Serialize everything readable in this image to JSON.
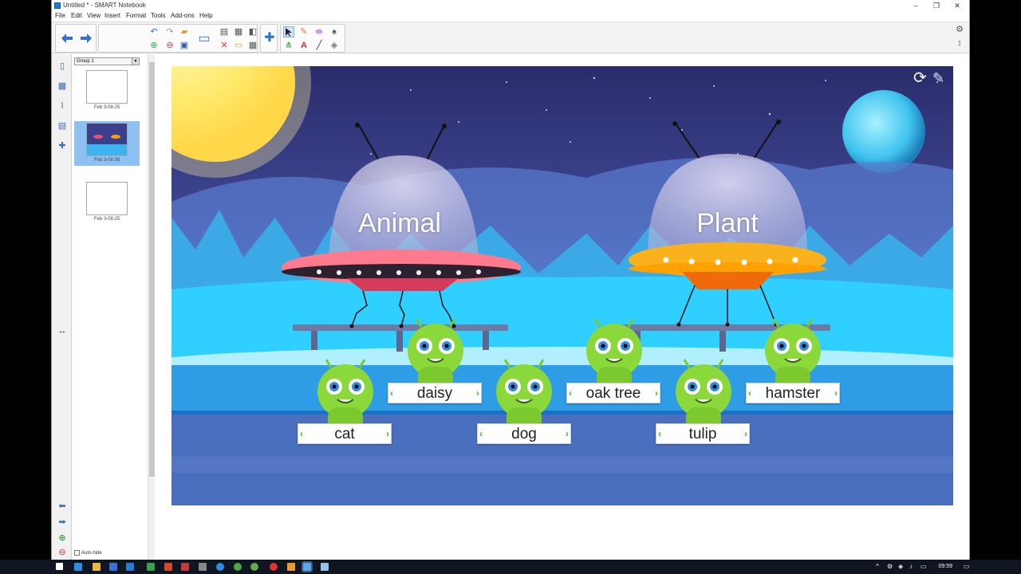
{
  "window": {
    "title": "Untitled * - SMART Notebook",
    "minimize": "–",
    "maximize": "❐",
    "close": "✕"
  },
  "menu": [
    "File",
    "Edit",
    "View",
    "Insert",
    "Format",
    "Tools",
    "Add-ons",
    "Help"
  ],
  "sorter": {
    "group": "Group 1",
    "pages": [
      {
        "label": "Feb 3-08:25",
        "selected": false
      },
      {
        "label": "Feb 3-08:58",
        "selected": true
      },
      {
        "label": "Feb 3-08:25",
        "selected": false
      }
    ],
    "autohide": "Auto-hide"
  },
  "activity": {
    "groups": [
      {
        "label": "Animal",
        "color": "#e8556b"
      },
      {
        "label": "Plant",
        "color": "#f5a10f"
      }
    ],
    "cards": [
      {
        "label": "daisy"
      },
      {
        "label": "oak tree"
      },
      {
        "label": "hamster"
      },
      {
        "label": "cat"
      },
      {
        "label": "dog"
      },
      {
        "label": "tulip"
      }
    ]
  },
  "taskbar": {
    "time": "09:59"
  }
}
